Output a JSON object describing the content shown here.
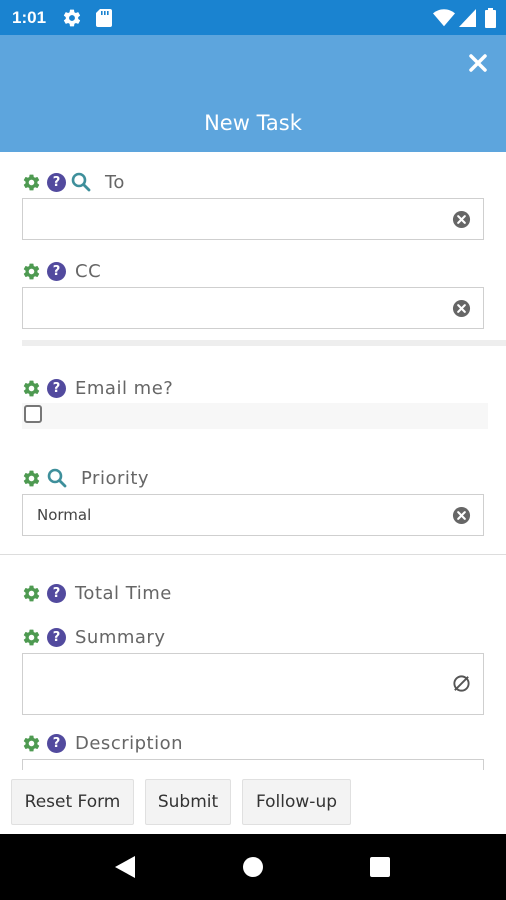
{
  "status_bar": {
    "time": "1:01"
  },
  "header": {
    "title": "New Task"
  },
  "fields": {
    "to": {
      "label": "To",
      "value": ""
    },
    "cc": {
      "label": "CC",
      "value": ""
    },
    "email_me": {
      "label": "Email me?",
      "checked": false
    },
    "priority": {
      "label": "Priority",
      "value": "Normal"
    },
    "total_time": {
      "label": "Total Time"
    },
    "summary": {
      "label": "Summary",
      "value": ""
    },
    "description": {
      "label": "Description",
      "value": ""
    }
  },
  "buttons": {
    "reset": "Reset Form",
    "submit": "Submit",
    "followup": "Follow-up"
  },
  "colors": {
    "status_bar": "#1a83d0",
    "header": "#5da5dd",
    "gear": "#4e9a51",
    "help": "#524a9e",
    "search": "#3e8f9b"
  }
}
